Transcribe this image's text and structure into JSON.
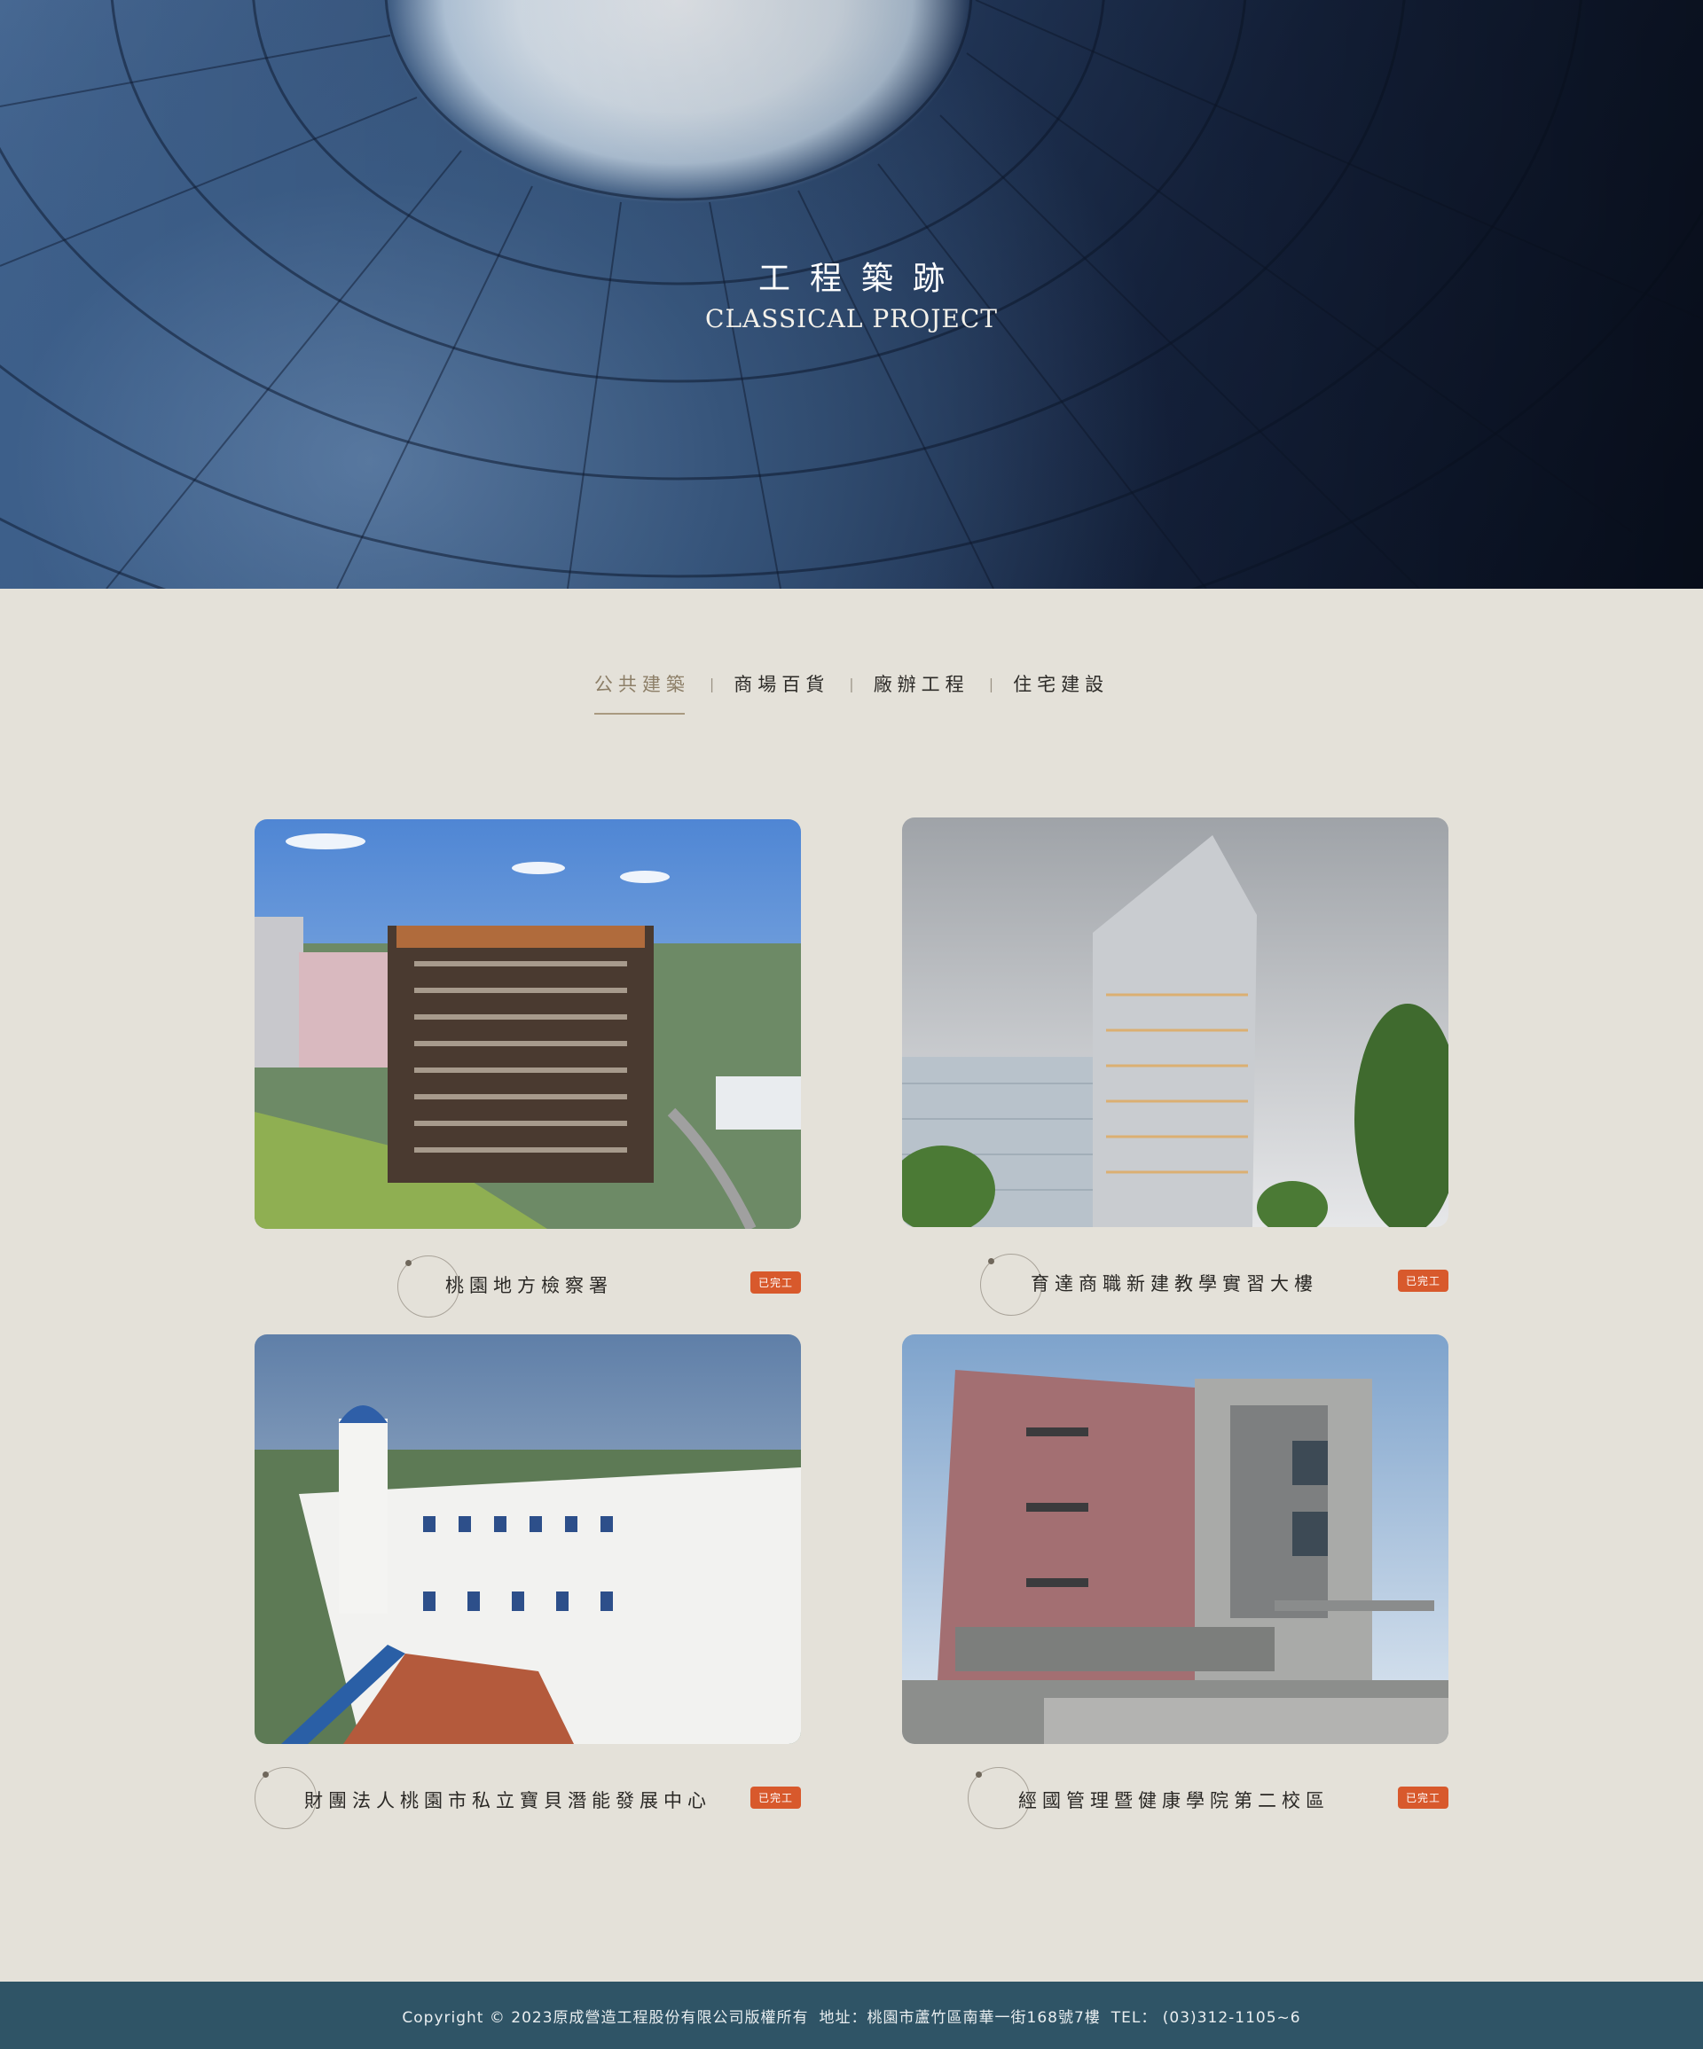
{
  "hero": {
    "title": "工程築跡",
    "subtitle": "CLASSICAL PROJECT"
  },
  "tabs": [
    {
      "label": "公共建築",
      "active": true
    },
    {
      "label": "商場百貨",
      "active": false
    },
    {
      "label": "廠辦工程",
      "active": false
    },
    {
      "label": "住宅建設",
      "active": false
    }
  ],
  "tab_separator": "|",
  "projects": [
    {
      "title": "桃園地方檢察署",
      "status": "已完工"
    },
    {
      "title": "育達商職新建教學實習大樓",
      "status": "已完工"
    },
    {
      "title": "財團法人桃園市私立寶貝潛能發展中心",
      "status": "已完工"
    },
    {
      "title": "經國管理暨健康學院第二校區",
      "status": "已完工"
    }
  ],
  "footer": {
    "copyright": "Copyright © 2023原成營造工程股份有限公司版權所有",
    "address": "地址：桃園市蘆竹區南華一街168號7樓",
    "tel": "TEL： (03)312-1105~6"
  },
  "colors": {
    "background": "#e4e1d9",
    "footer": "#2f5466",
    "badge": "#d8592c",
    "active_tab": "#8d7f68"
  }
}
